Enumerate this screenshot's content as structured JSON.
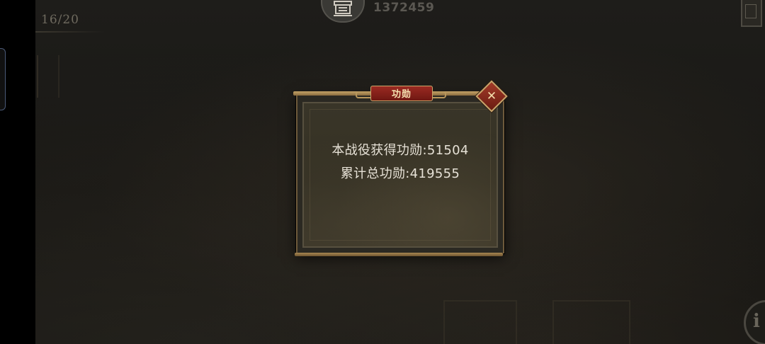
{
  "hud": {
    "wave_counter": "16/20",
    "score": "1372459",
    "emblem_icon": "faction-emblem-icon",
    "info_glyph": "i"
  },
  "dialog": {
    "title": "功勋",
    "close_glyph": "✕",
    "battle_merit_line": "本战役获得功勋:51504",
    "total_merit_line": "累计总功勋:419555"
  },
  "colors": {
    "frame_gold": "#c4a366",
    "title_red": "#9b2a22",
    "body_text": "#e6e1d6"
  }
}
